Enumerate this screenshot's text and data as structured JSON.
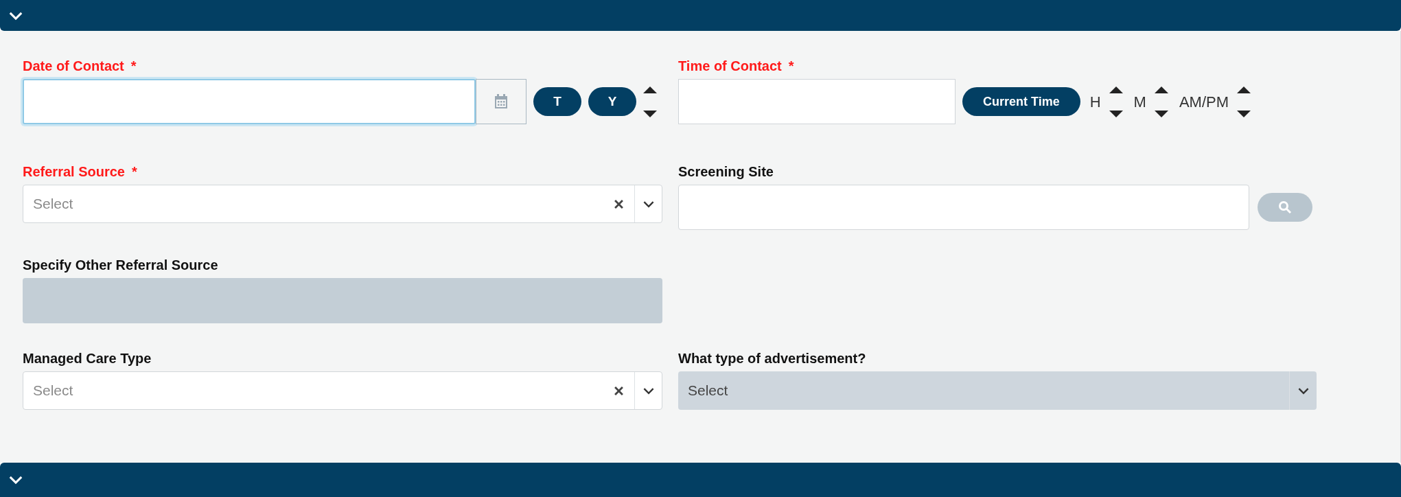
{
  "rows": [
    [
      {
        "kind": "date",
        "label": "Date of Contact",
        "required": true,
        "required_mark": "*",
        "focused": true,
        "buttons": [
          "T",
          "Y"
        ]
      },
      {
        "kind": "time",
        "label": "Time of Contact",
        "required": true,
        "required_mark": "*",
        "button": "Current Time",
        "units": [
          "H",
          "M",
          "AM/PM"
        ]
      }
    ],
    [
      {
        "kind": "select",
        "label": "Referral Source",
        "required": true,
        "required_mark": "*",
        "placeholder": "Select",
        "clearable": true,
        "disabled": false
      },
      {
        "kind": "lookup",
        "label": "Screening Site",
        "required": false
      }
    ],
    [
      {
        "kind": "text",
        "label": "Specify Other Referral Source",
        "required": false,
        "disabled": true
      }
    ],
    [
      {
        "kind": "select",
        "label": "Managed Care Type",
        "required": false,
        "placeholder": "Select",
        "clearable": true,
        "disabled": false
      },
      {
        "kind": "select",
        "label": "What type of advertisement?",
        "required": false,
        "placeholder": "Select",
        "clearable": false,
        "disabled": true
      }
    ]
  ]
}
